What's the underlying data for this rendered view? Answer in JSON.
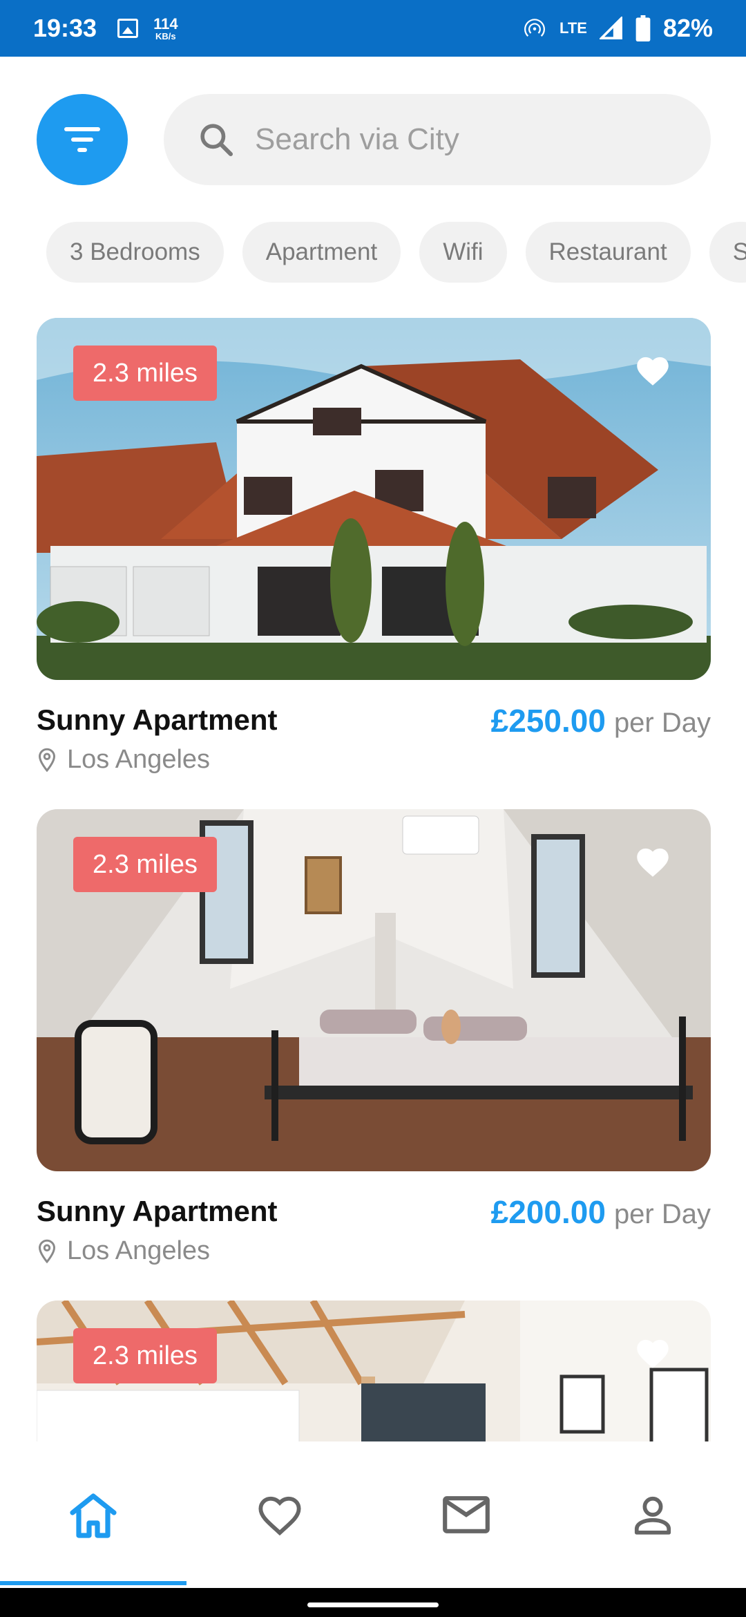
{
  "status_bar": {
    "time": "19:33",
    "net_speed_value": "114",
    "net_speed_unit": "KB/s",
    "network": "LTE",
    "battery": "82%"
  },
  "search": {
    "placeholder": "Search via City"
  },
  "chips": [
    "3 Bedrooms",
    "Apartment",
    "Wifi",
    "Restaurant",
    "S"
  ],
  "listings": [
    {
      "distance": "2.3 miles",
      "title": "Sunny Apartment",
      "price": "£250.00",
      "price_unit": "per Day",
      "location": "Los Angeles"
    },
    {
      "distance": "2.3 miles",
      "title": "Sunny Apartment",
      "price": "£200.00",
      "price_unit": "per Day",
      "location": "Los Angeles"
    },
    {
      "distance": "2.3 miles"
    }
  ],
  "bottom_nav": {
    "active": "home",
    "items": [
      "home-icon",
      "heart-icon",
      "mail-icon",
      "person-icon"
    ]
  },
  "colors": {
    "accent": "#1e9bf0",
    "status_bar": "#0a6fc6",
    "badge": "#ee6a6a"
  }
}
